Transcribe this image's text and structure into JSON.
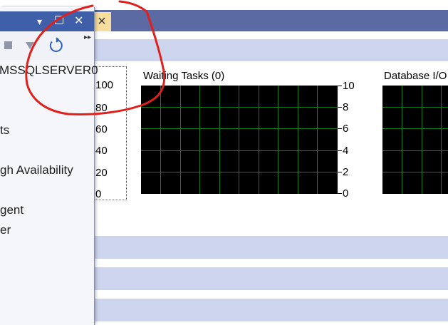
{
  "tab": {
    "close_glyph": "×"
  },
  "performance": {
    "ticks_0_100": [
      "100",
      "80",
      "60",
      "40",
      "20",
      "0"
    ],
    "waiting_tasks": {
      "title": "Waiting Tasks (0)",
      "ticks": [
        "10",
        "8",
        "6",
        "4",
        "2",
        "0"
      ]
    },
    "database_io": {
      "title": "Database I/O"
    }
  },
  "object_explorer": {
    "title_controls": {
      "pin": "▾",
      "restore": "☐",
      "close": "✕"
    },
    "toolbar": {
      "overflow_glyph": "▸▸"
    },
    "tree": {
      "server": "MSSQLSERVER0",
      "items": [
        "ts",
        "gh Availability",
        "gent",
        "er"
      ]
    }
  },
  "colors": {
    "tab_bar": "#5b6aa3",
    "band": "#cdd5ee",
    "chart_grid": "#1a7a1a",
    "annotation": "#e0201c"
  }
}
